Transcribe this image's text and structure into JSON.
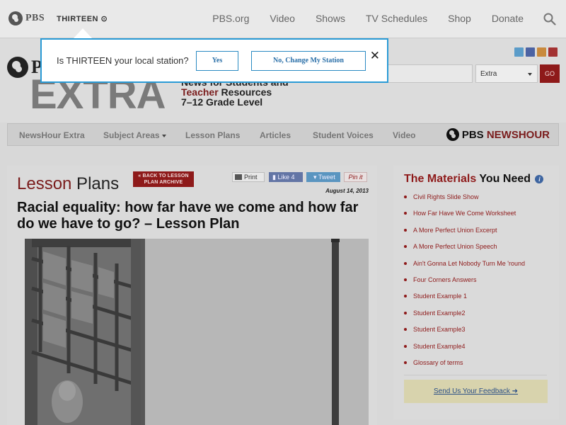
{
  "topbar": {
    "pbs_label": "PBS",
    "station_label": "THIRTEEN",
    "nav": [
      "PBS.org",
      "Video",
      "Shows",
      "TV Schedules",
      "Shop",
      "Donate"
    ]
  },
  "header": {
    "logo_letter": "P",
    "extra_word": "EXTRA",
    "tagline_line1": "News for Students and",
    "tagline_teacher": "Teacher",
    "tagline_resources": " Resources",
    "tagline_line3": "7–12 Grade Level",
    "search_select_value": "Extra",
    "go_label": "GO",
    "social_colors": [
      "#5b9cc9",
      "#4c63a3",
      "#c98a3d",
      "#a33232"
    ]
  },
  "mainnav": {
    "items": [
      "NewsHour Extra",
      "Subject Areas",
      "Lesson Plans",
      "Articles",
      "Student Voices",
      "Video"
    ],
    "logo_pbs": "PBS",
    "logo_news": "NEWS",
    "logo_hour": "HOUR"
  },
  "content": {
    "title_red": "Lesson",
    "title_rest": " Plans",
    "back_line1": "« BACK TO LESSON",
    "back_line2": "PLAN ARCHIVE",
    "print_label": "Print",
    "like_label": "Like 4",
    "tweet_label": "Tweet",
    "pin_label": "Pin it",
    "date": "August 14, 2013",
    "headline": "Racial equality: how far have we come and how far do we have to go? – Lesson Plan"
  },
  "sidebar": {
    "title_red": "The Materials",
    "title_rest": " You Need",
    "info_icon": "i",
    "items": [
      "Civil Rights Slide Show",
      "How Far Have We Come Worksheet",
      "A More Perfect Union Excerpt",
      "A More Perfect Union Speech",
      "Ain't Gonna Let Nobody Turn Me 'round",
      "Four Corners Answers",
      "Student Example 1",
      "Student Example2",
      "Student Example3",
      "Student Example4",
      "Glossary of terms"
    ],
    "feedback_label": "Send Us Your Feedback ➜"
  },
  "popup": {
    "question": "Is THIRTEEN your local station?",
    "yes_label": "Yes",
    "change_label": "No, Change My Station",
    "close_label": "✕"
  },
  "colors": {
    "accent_blue": "#2a9bd6",
    "brand_red": "#8e1a1a"
  }
}
